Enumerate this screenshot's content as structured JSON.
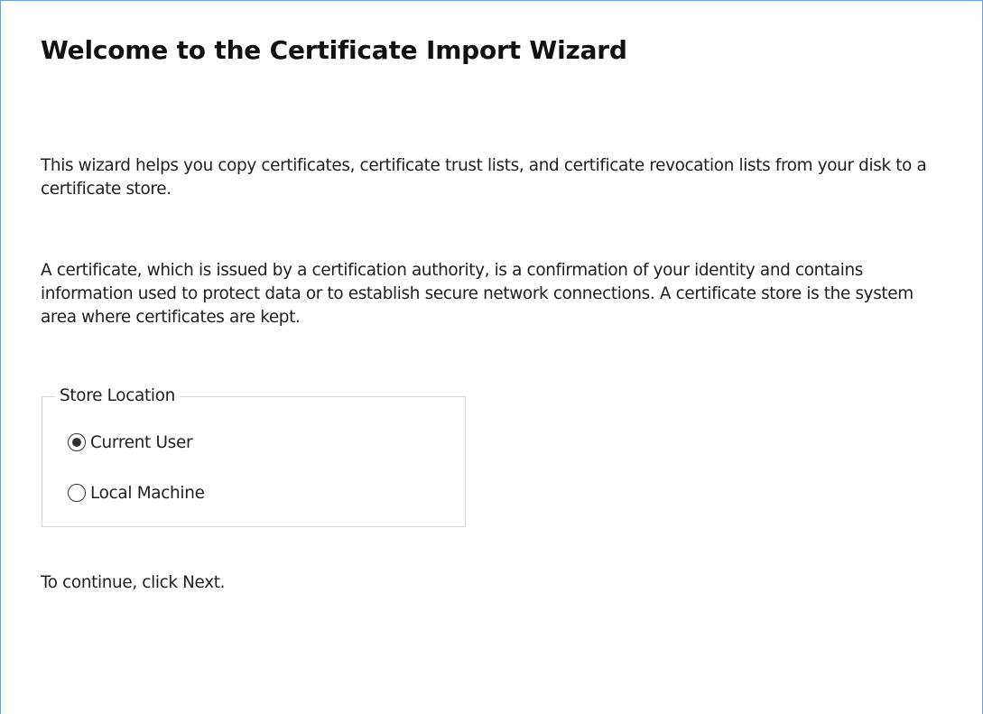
{
  "wizard": {
    "title": "Welcome to the Certificate Import Wizard",
    "intro_text": "This wizard helps you copy certificates, certificate trust lists, and certificate revocation lists from your disk to a certificate store.",
    "description_text": "A certificate, which is issued by a certification authority, is a confirmation of your identity and contains information used to protect data or to establish secure network connections. A certificate store is the system area where certificates are kept.",
    "store_location": {
      "legend": "Store Location",
      "options": [
        {
          "label": "Current User",
          "selected": true
        },
        {
          "label": "Local Machine",
          "selected": false
        }
      ]
    },
    "footer_text": "To continue, click Next."
  },
  "colors": {
    "window_border": "#6f9fd3",
    "text": "#1e1e1e",
    "groupbox_border": "#d7d7d7",
    "radio": "#333333"
  }
}
